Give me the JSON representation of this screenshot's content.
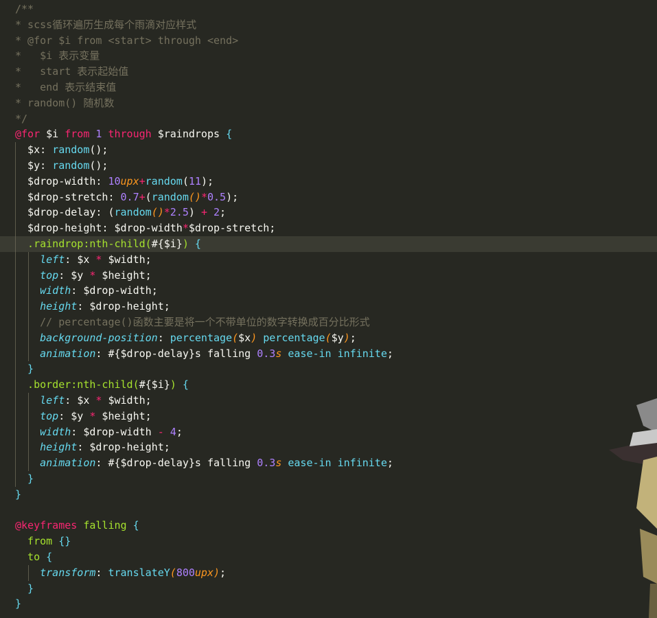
{
  "lines": [
    [
      [
        "c-comment",
        "/**"
      ]
    ],
    [
      [
        "c-comment",
        "* scss循环遍历生成每个雨滴对应样式"
      ]
    ],
    [
      [
        "c-comment",
        "* @for $i from <start> through <end>"
      ]
    ],
    [
      [
        "c-comment",
        "*   $i 表示变量"
      ]
    ],
    [
      [
        "c-comment",
        "*   start 表示起始值"
      ]
    ],
    [
      [
        "c-comment",
        "*   end 表示结束值"
      ]
    ],
    [
      [
        "c-comment",
        "* random() 随机数"
      ]
    ],
    [
      [
        "c-comment",
        "*/"
      ]
    ],
    [
      [
        "c-at",
        "@for"
      ],
      [
        "c-var",
        " $i "
      ],
      [
        "c-kw",
        "from"
      ],
      [
        "c-num",
        " 1 "
      ],
      [
        "c-kw",
        "through"
      ],
      [
        "c-var",
        " $raindrops "
      ],
      [
        "c-brace",
        "{"
      ]
    ],
    [
      [
        "c-var",
        "  $x"
      ],
      [
        "c-punct",
        ": "
      ],
      [
        "c-func",
        "random"
      ],
      [
        "c-paren",
        "();"
      ]
    ],
    [
      [
        "c-var",
        "  $y"
      ],
      [
        "c-punct",
        ": "
      ],
      [
        "c-func",
        "random"
      ],
      [
        "c-paren",
        "();"
      ]
    ],
    [
      [
        "c-var",
        "  $drop-width"
      ],
      [
        "c-punct",
        ": "
      ],
      [
        "c-num",
        "10"
      ],
      [
        "c-unit",
        "upx"
      ],
      [
        "c-op",
        "+"
      ],
      [
        "c-func",
        "random"
      ],
      [
        "c-paren",
        "("
      ],
      [
        "c-num",
        "11"
      ],
      [
        "c-paren",
        ");"
      ]
    ],
    [
      [
        "c-var",
        "  $drop-stretch"
      ],
      [
        "c-punct",
        ": "
      ],
      [
        "c-num",
        "0.7"
      ],
      [
        "c-op",
        "+"
      ],
      [
        "c-paren",
        "("
      ],
      [
        "c-func",
        "random"
      ],
      [
        "c-unit",
        "()"
      ],
      [
        "c-op",
        "*"
      ],
      [
        "c-num",
        "0.5"
      ],
      [
        "c-paren",
        ");"
      ]
    ],
    [
      [
        "c-var",
        "  $drop-delay"
      ],
      [
        "c-punct",
        ": "
      ],
      [
        "c-paren",
        "("
      ],
      [
        "c-func",
        "random"
      ],
      [
        "c-unit",
        "()"
      ],
      [
        "c-op",
        "*"
      ],
      [
        "c-num",
        "2.5"
      ],
      [
        "c-paren",
        ") "
      ],
      [
        "c-op",
        "+"
      ],
      [
        "c-num",
        " 2"
      ],
      [
        "c-punct",
        ";"
      ]
    ],
    [
      [
        "c-var",
        "  $drop-height"
      ],
      [
        "c-punct",
        ": "
      ],
      [
        "c-var",
        "$drop-width"
      ],
      [
        "c-op",
        "*"
      ],
      [
        "c-var",
        "$drop-stretch"
      ],
      [
        "c-punct",
        ";"
      ]
    ],
    [
      [
        "c-sel",
        "  .raindrop:nth-child("
      ],
      [
        "c-interp",
        "#{$i}"
      ],
      [
        "c-sel",
        ")"
      ],
      [
        "c-brace",
        " {"
      ]
    ],
    [
      [
        "c-prop",
        "    left"
      ],
      [
        "c-punct",
        ": "
      ],
      [
        "c-var",
        "$x "
      ],
      [
        "c-op",
        "*"
      ],
      [
        "c-var",
        " $width"
      ],
      [
        "c-punct",
        ";"
      ]
    ],
    [
      [
        "c-prop",
        "    top"
      ],
      [
        "c-punct",
        ": "
      ],
      [
        "c-var",
        "$y "
      ],
      [
        "c-op",
        "*"
      ],
      [
        "c-var",
        " $height"
      ],
      [
        "c-punct",
        ";"
      ]
    ],
    [
      [
        "c-prop",
        "    width"
      ],
      [
        "c-punct",
        ": "
      ],
      [
        "c-var",
        "$drop-width"
      ],
      [
        "c-punct",
        ";"
      ]
    ],
    [
      [
        "c-prop",
        "    height"
      ],
      [
        "c-punct",
        ": "
      ],
      [
        "c-var",
        "$drop-height"
      ],
      [
        "c-punct",
        ";"
      ]
    ],
    [
      [
        "c-comment",
        "    // percentage()函数主要是将一个不带单位的数字转换成百分比形式"
      ]
    ],
    [
      [
        "c-prop",
        "    background-position"
      ],
      [
        "c-punct",
        ": "
      ],
      [
        "c-value",
        "percentage"
      ],
      [
        "c-unit",
        "("
      ],
      [
        "c-var",
        "$x"
      ],
      [
        "c-unit",
        ")"
      ],
      [
        "c-value",
        " percentage"
      ],
      [
        "c-unit",
        "("
      ],
      [
        "c-var",
        "$y"
      ],
      [
        "c-unit",
        ")"
      ],
      [
        "c-punct",
        ";"
      ]
    ],
    [
      [
        "c-prop",
        "    animation"
      ],
      [
        "c-punct",
        ": "
      ],
      [
        "c-interp",
        "#{$drop-delay}s falling "
      ],
      [
        "c-num",
        "0.3"
      ],
      [
        "c-unit",
        "s"
      ],
      [
        "c-value",
        " ease-in infinite"
      ],
      [
        "c-punct",
        ";"
      ]
    ],
    [
      [
        "c-brace",
        "  }"
      ]
    ],
    [
      [
        "c-sel",
        "  .border:nth-child("
      ],
      [
        "c-interp",
        "#{$i}"
      ],
      [
        "c-sel",
        ")"
      ],
      [
        "c-brace",
        " {"
      ]
    ],
    [
      [
        "c-prop",
        "    left"
      ],
      [
        "c-punct",
        ": "
      ],
      [
        "c-var",
        "$x "
      ],
      [
        "c-op",
        "*"
      ],
      [
        "c-var",
        " $width"
      ],
      [
        "c-punct",
        ";"
      ]
    ],
    [
      [
        "c-prop",
        "    top"
      ],
      [
        "c-punct",
        ": "
      ],
      [
        "c-var",
        "$y "
      ],
      [
        "c-op",
        "*"
      ],
      [
        "c-var",
        " $height"
      ],
      [
        "c-punct",
        ";"
      ]
    ],
    [
      [
        "c-prop",
        "    width"
      ],
      [
        "c-punct",
        ": "
      ],
      [
        "c-var",
        "$drop-width "
      ],
      [
        "c-op",
        "-"
      ],
      [
        "c-num",
        " 4"
      ],
      [
        "c-punct",
        ";"
      ]
    ],
    [
      [
        "c-prop",
        "    height"
      ],
      [
        "c-punct",
        ": "
      ],
      [
        "c-var",
        "$drop-height"
      ],
      [
        "c-punct",
        ";"
      ]
    ],
    [
      [
        "c-prop",
        "    animation"
      ],
      [
        "c-punct",
        ": "
      ],
      [
        "c-interp",
        "#{$drop-delay}s falling "
      ],
      [
        "c-num",
        "0.3"
      ],
      [
        "c-unit",
        "s"
      ],
      [
        "c-value",
        " ease-in infinite"
      ],
      [
        "c-punct",
        ";"
      ]
    ],
    [
      [
        "c-brace",
        "  }"
      ]
    ],
    [
      [
        "c-brace",
        "}"
      ]
    ],
    [
      [
        "c-punct",
        ""
      ]
    ],
    [
      [
        "c-at",
        "@keyframes"
      ],
      [
        "c-kfname",
        " falling "
      ],
      [
        "c-brace",
        "{"
      ]
    ],
    [
      [
        "c-kfsel",
        "  from"
      ],
      [
        "c-brace",
        " {}"
      ]
    ],
    [
      [
        "c-kfsel",
        "  to"
      ],
      [
        "c-brace",
        " {"
      ]
    ],
    [
      [
        "c-prop",
        "    transform"
      ],
      [
        "c-punct",
        ": "
      ],
      [
        "c-func",
        "translateY"
      ],
      [
        "c-unit",
        "("
      ],
      [
        "c-num",
        "800"
      ],
      [
        "c-unit",
        "upx"
      ],
      [
        "c-unit",
        ")"
      ],
      [
        "c-punct",
        ";"
      ]
    ],
    [
      [
        "c-brace",
        "  }"
      ]
    ],
    [
      [
        "c-brace",
        "}"
      ]
    ]
  ],
  "active_line": 15,
  "colors": {
    "background": "#272822",
    "comment": "#75715e",
    "keyword": "#f92672",
    "number": "#ae81ff",
    "function": "#66d9ef",
    "selector": "#a6e22e",
    "unit": "#fd971f"
  }
}
